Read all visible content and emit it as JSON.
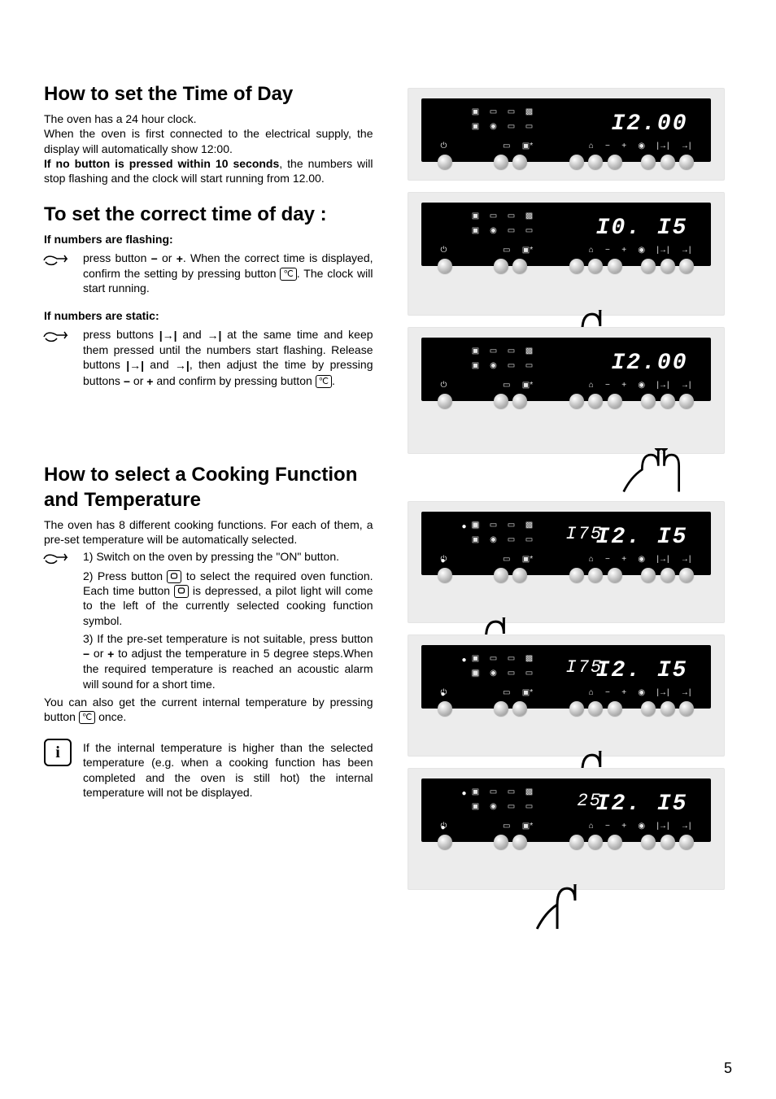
{
  "s1": {
    "h": "How to set the Time of Day",
    "p1": "The oven has a 24 hour clock.",
    "p2": "When the oven is first connected to the electrical supply, the display will automatically show 12:00.",
    "p3a": "If no button is pressed within 10 seconds",
    "p3b": ", the numbers will stop flashing and the clock will start running from 12.00."
  },
  "s2": {
    "h": "To set the correct time of day :",
    "sub1": "If numbers are flashing:",
    "l1a": "press button ",
    "minus": "−",
    "l1b": " or ",
    "plus": "+",
    "l1c": ". When the correct time is displayed, confirm the setting by pressing button ",
    "clockbtn": "℃",
    "l1d": ". The clock will start running.",
    "sub2": "If numbers are static:",
    "l2a": "press buttons ",
    "arr1": "|→|",
    "l2b": " and ",
    "arr2": "→|",
    "l2c": " at the same time and keep them pressed until the numbers start flashing. Release buttons ",
    "l2d": " and ",
    "l2e": ", then adjust the time by pressing buttons ",
    "l2f": " or ",
    "l2g": " and confirm by pressing button ",
    "l2h": "."
  },
  "s3": {
    "h": "How to select a Cooking Function and Temperature",
    "p1": "The oven has 8 different cooking functions. For each of them, a pre-set temperature will be automatically selected.",
    "step1": "1)  Switch on the oven by pressing the \"ON\" button.",
    "step2a": "2)  Press button ",
    "oven": "▭",
    "step2b": " to select the required oven function. Each time button ",
    "step2c": " is depressed, a pilot light will come to the left of the currently selected cooking function symbol.",
    "step3a": "3)  If the pre-set temperature is not suitable, press button ",
    "step3b": " or ",
    "step3c": "  to adjust the temperature in 5 degree steps.When the required temperature is reached an acoustic alarm will sound for a short time.",
    "p2a": "You can also get the current internal temperature by pressing button ",
    "p2b": " once.",
    "info": "If the internal temperature is higher than the selected temperature (e.g. when a cooking function has been completed and the oven is still hot) the internal temperature will not be displayed."
  },
  "panels": {
    "a": {
      "time": "I2.00",
      "temp": ""
    },
    "b": {
      "time": "I0. I5",
      "temp": ""
    },
    "c": {
      "time": "I2.00",
      "temp": ""
    },
    "d": {
      "time": "I2. I5",
      "temp": "I75"
    },
    "e": {
      "time": "I2. I5",
      "temp": "I75"
    },
    "f": {
      "time": "I2. I5",
      "temp": "25"
    }
  },
  "pageNumber": "5"
}
